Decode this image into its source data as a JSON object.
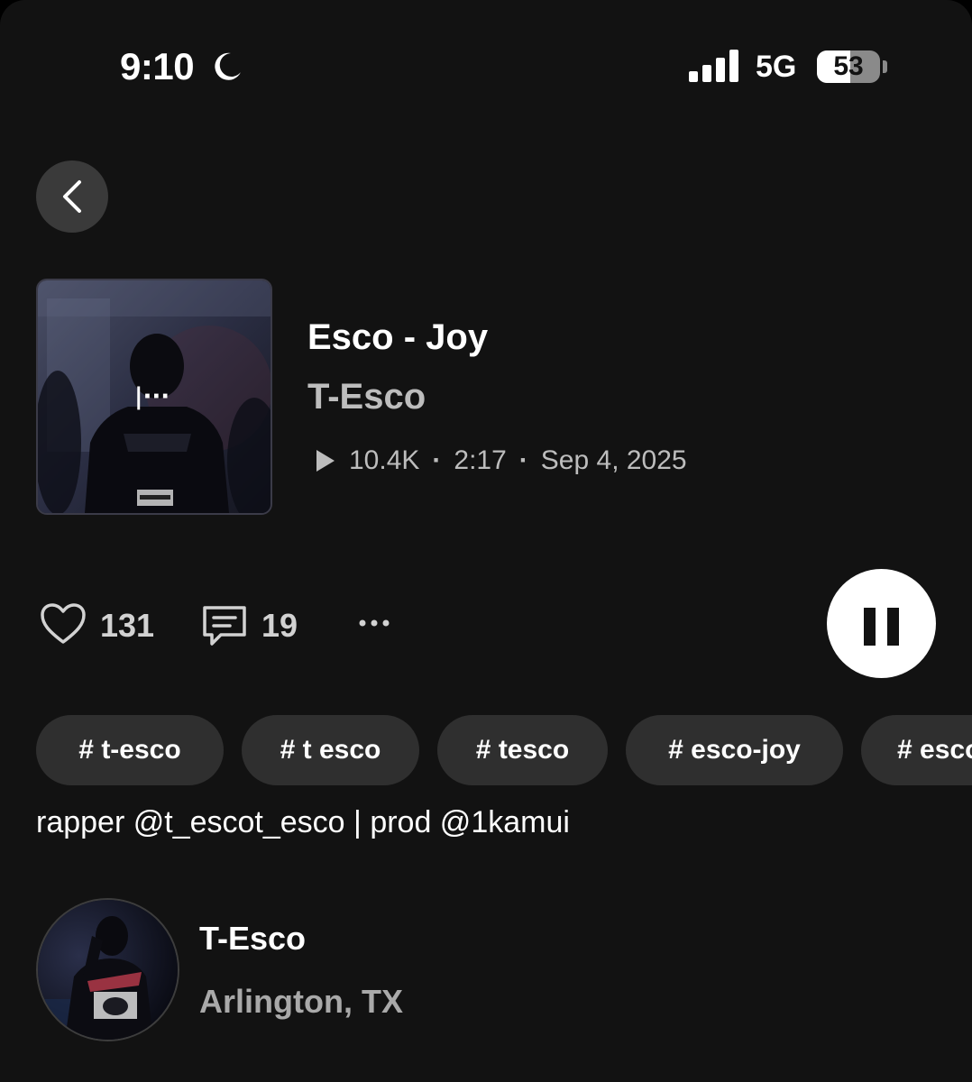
{
  "status_bar": {
    "time": "9:10",
    "network": "5G",
    "battery_percent": "53",
    "battery_level": 0.53,
    "signal_bars": 4,
    "icons": [
      "moon-icon",
      "signal-icon",
      "battery-icon"
    ]
  },
  "nav": {
    "back_icon": "chevron-left-icon"
  },
  "track": {
    "title": "Esco - Joy",
    "artist": "T-Esco",
    "plays": "10.4K",
    "duration": "2:17",
    "date": "Sep 4, 2025",
    "separator": "·"
  },
  "actions": {
    "likes": "131",
    "comments": "19",
    "icons": [
      "heart-icon",
      "comment-icon",
      "more-icon",
      "pause-icon"
    ]
  },
  "tags": [
    "# t-esco",
    "# t esco",
    "# tesco",
    "# esco-joy",
    "# esco"
  ],
  "description": "rapper @t_escot_esco | prod @1kamui",
  "profile": {
    "name": "T-Esco",
    "location": "Arlington, TX"
  },
  "colors": {
    "background": "#121212",
    "chip": "#2f2f2f",
    "secondary_text": "#bdbdbd",
    "button": "#3a3a3a"
  }
}
